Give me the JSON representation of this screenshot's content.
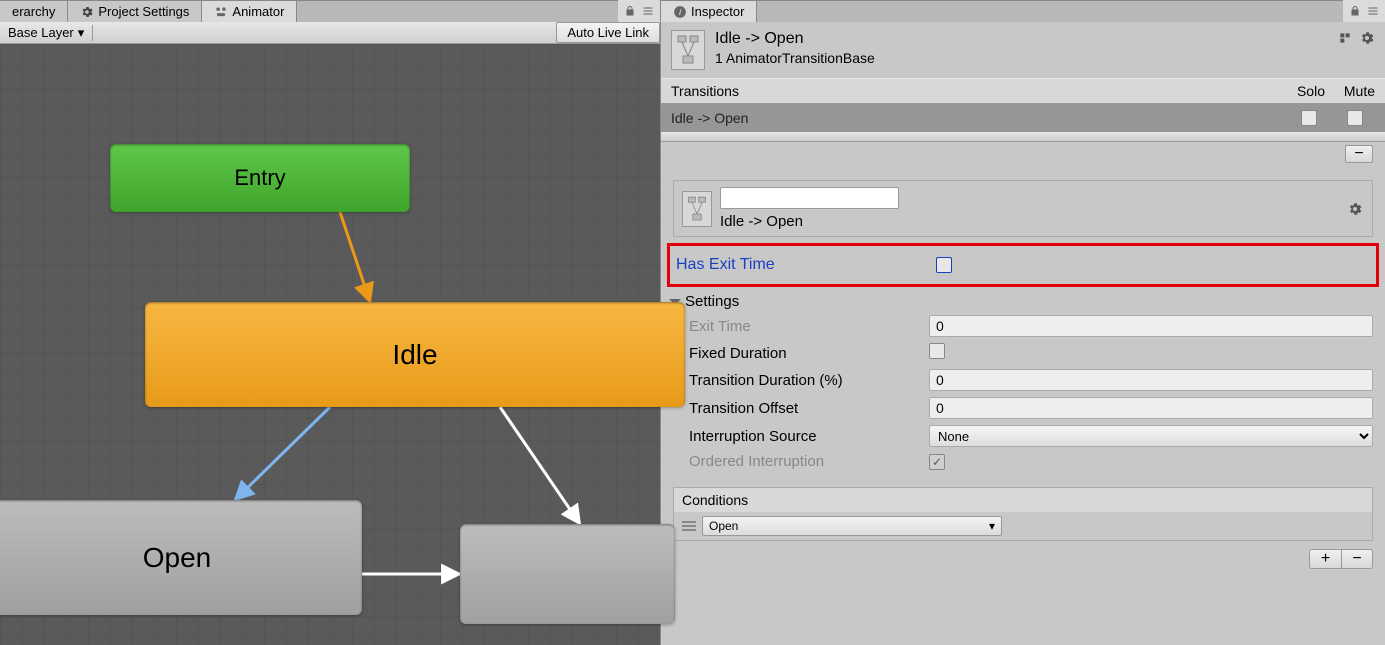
{
  "tabs_left": [
    {
      "label": "erarchy",
      "icon": "hierarchy"
    },
    {
      "label": "Project Settings",
      "icon": "gear"
    },
    {
      "label": "Animator",
      "icon": "animator",
      "active": true
    }
  ],
  "tabs_right": [
    {
      "label": "Inspector",
      "icon": "info",
      "active": true
    }
  ],
  "layer_selector": "Base Layer",
  "auto_live_link": "Auto Live Link",
  "animator_nodes": {
    "entry": "Entry",
    "idle": "Idle",
    "open": "Open"
  },
  "inspector": {
    "title": "Idle -> Open",
    "subtitle": "1 AnimatorTransitionBase",
    "transitions_header": "Transitions",
    "col_solo": "Solo",
    "col_mute": "Mute",
    "transition_row": "Idle -> Open",
    "name_field_value": "",
    "name_sub": "Idle -> Open",
    "has_exit_time": "Has Exit Time",
    "settings_label": "Settings",
    "props": {
      "exit_time": {
        "label": "Exit Time",
        "value": "0"
      },
      "fixed_duration": {
        "label": "Fixed Duration",
        "checked": false
      },
      "transition_duration": {
        "label": "Transition Duration (%)",
        "value": "0"
      },
      "transition_offset": {
        "label": "Transition Offset",
        "value": "0"
      },
      "interruption_source": {
        "label": "Interruption Source",
        "value": "None"
      },
      "ordered_interruption": {
        "label": "Ordered Interruption",
        "checked": true
      }
    },
    "conditions_header": "Conditions",
    "condition_value": "Open"
  }
}
